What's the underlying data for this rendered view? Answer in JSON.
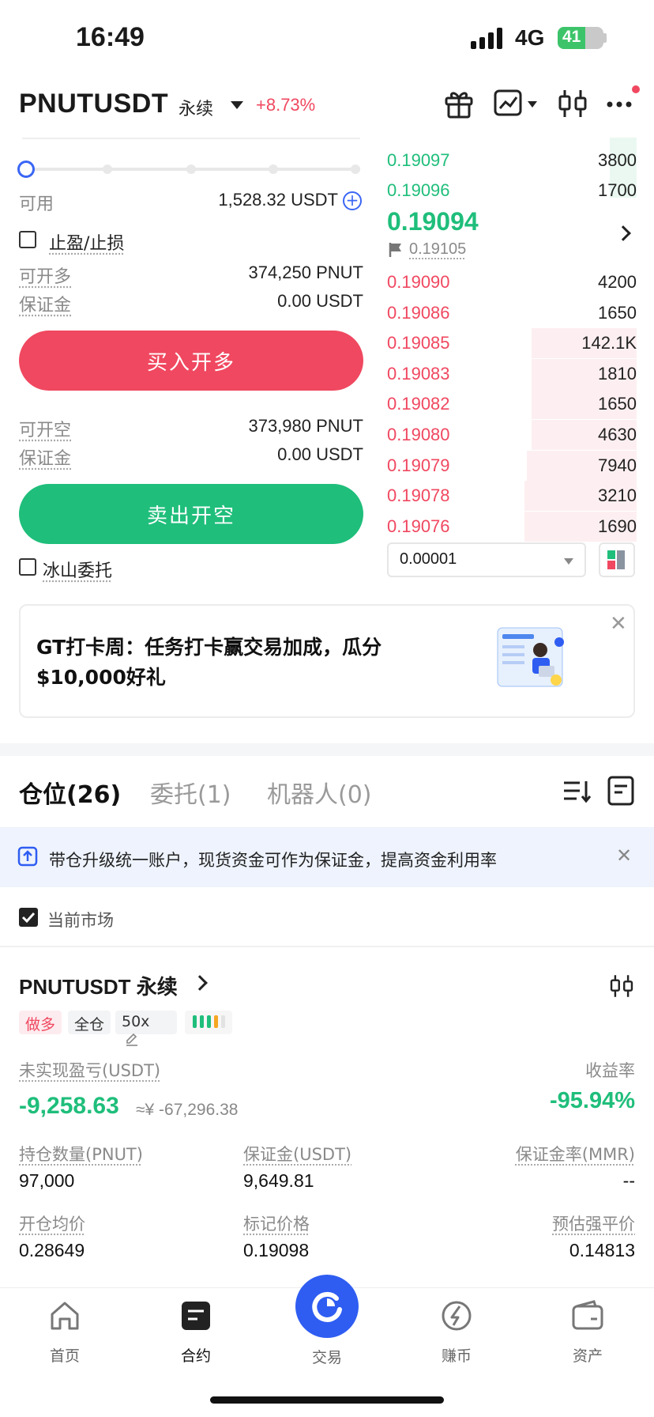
{
  "status_bar": {
    "time": "16:49",
    "network": "4G",
    "battery": "41"
  },
  "header": {
    "pair": "PNUTUSDT",
    "contract_type": "永续",
    "change": "+8.73%",
    "icons": [
      "gift-icon",
      "chart-icon",
      "candlestick-icon",
      "more-icon"
    ]
  },
  "order_form": {
    "available_label": "可用",
    "available_value": "1,528.32 USDT",
    "tpsl_label": "止盈/止损",
    "long": {
      "max_label": "可开多",
      "max_value": "374,250 PNUT",
      "margin_label": "保证金",
      "margin_value": "0.00 USDT",
      "button": "买入开多"
    },
    "short": {
      "max_label": "可开空",
      "max_value": "373,980 PNUT",
      "margin_label": "保证金",
      "margin_value": "0.00 USDT",
      "button": "卖出开空"
    },
    "iceberg_label": "冰山委托"
  },
  "order_book": {
    "top_bids": [
      {
        "price": "0.19097",
        "qty": "3800"
      },
      {
        "price": "0.19096",
        "qty": "1700"
      }
    ],
    "last_price": "0.19094",
    "mark_price": "0.19105",
    "asks": [
      {
        "price": "0.19090",
        "qty": "4200",
        "depth": 0.0
      },
      {
        "price": "0.19086",
        "qty": "1650",
        "depth": 0.0
      },
      {
        "price": "0.19085",
        "qty": "142.1K",
        "depth": 0.42
      },
      {
        "price": "0.19083",
        "qty": "1810",
        "depth": 0.42
      },
      {
        "price": "0.19082",
        "qty": "1650",
        "depth": 0.42
      },
      {
        "price": "0.19080",
        "qty": "4630",
        "depth": 0.42
      },
      {
        "price": "0.19079",
        "qty": "7940",
        "depth": 0.44
      },
      {
        "price": "0.19078",
        "qty": "3210",
        "depth": 0.45
      },
      {
        "price": "0.19076",
        "qty": "1690",
        "depth": 0.45
      }
    ],
    "precision": "0.00001"
  },
  "promo": {
    "text": "GT打卡周：任务打卡赢交易加成，瓜分$10,000好礼"
  },
  "tabs": [
    {
      "label": "仓位(26)",
      "active": true
    },
    {
      "label": "委托(1)",
      "active": false
    },
    {
      "label": "机器人(0)",
      "active": false
    }
  ],
  "notice": {
    "text": "带仓升级统一账户，现货资金可作为保证金，提高资金利用率"
  },
  "filter": {
    "label": "当前市场"
  },
  "position": {
    "title": "PNUTUSDT 永续",
    "side_tag": "做多",
    "mode_tag": "全仓",
    "leverage_tag": "50x",
    "pnl_label": "未实现盈亏(USDT)",
    "pnl_value": "-9,258.63",
    "pnl_cny": "≈¥ -67,296.38",
    "roi_label": "收益率",
    "roi_value": "-95.94%",
    "qty_label": "持仓数量(PNUT)",
    "qty_value": "97,000",
    "margin_label": "保证金(USDT)",
    "margin_value": "9,649.81",
    "mmr_label": "保证金率(MMR)",
    "mmr_value": "--",
    "entry_label": "开仓均价",
    "entry_value": "0.28649",
    "mark_label": "标记价格",
    "mark_value": "0.19098",
    "liq_label": "预估强平价",
    "liq_value": "0.14813"
  },
  "bottom_nav": [
    {
      "label": "首页",
      "icon": "home-icon"
    },
    {
      "label": "合约",
      "icon": "futures-icon",
      "active": true
    },
    {
      "label": "交易",
      "icon": "trade-icon"
    },
    {
      "label": "赚币",
      "icon": "earn-icon"
    },
    {
      "label": "资产",
      "icon": "wallet-icon"
    }
  ],
  "colors": {
    "red": "#f04860",
    "green": "#1fbe7b",
    "blue": "#2f5df2"
  }
}
